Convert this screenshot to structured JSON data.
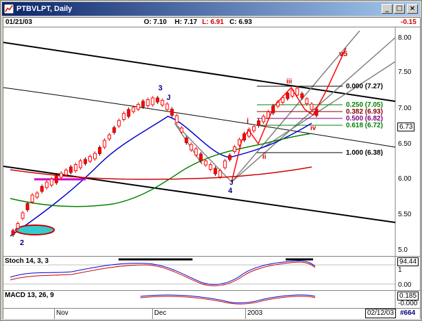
{
  "window": {
    "title": "PTBVLPT, Daily",
    "buttons": [
      "_",
      "□",
      "×"
    ]
  },
  "infobar": {
    "date": "01/21/03",
    "open": "O: 7.10",
    "high": "H: 7.17",
    "low": "L: 6.91",
    "close": "C: 6.93",
    "change": "-0.15"
  },
  "price_axis": {
    "ticks": [
      "8.00",
      "7.50",
      "7.00",
      "6.50",
      "6.00",
      "5.50",
      "5.0"
    ],
    "current": "6.73"
  },
  "fibonacci": [
    {
      "label": "0.000 (7.27)",
      "color": "#000000"
    },
    {
      "label": "0.250 (7.05)",
      "color": "#008000"
    },
    {
      "label": "0.382 (6.93)",
      "color": "#800000"
    },
    {
      "label": "0.500 (6.82)",
      "color": "#800080"
    },
    {
      "label": "0.618 (6.72)",
      "color": "#008000"
    },
    {
      "label": "1.000 (6.38)",
      "color": "#000000"
    }
  ],
  "wave_labels": {
    "w2": "2",
    "w3": "3",
    "w4": "4",
    "j1": "J",
    "j2": "J",
    "i": "i",
    "ii": "ii",
    "iii": "iii",
    "iv": "iv",
    "v5": "v5"
  },
  "stoch": {
    "title": "Stoch 14, 3, 3",
    "value": "94.44",
    "ticks": [
      "1",
      "0.00"
    ]
  },
  "macd": {
    "title": "MACD 13, 26, 9",
    "value": "0.185",
    "value2": "-0.000"
  },
  "dates": {
    "nov": "Nov",
    "dec": "Dec",
    "y2003": "2003",
    "cursor_date": "02/12/03",
    "bar_count": "#664"
  },
  "colors": {
    "up": "#ff0000",
    "ma_short": "#0000cc",
    "ma_mid": "#008000",
    "ma_long": "#cc0000",
    "channel": "#000000",
    "pitchfork": "#808080"
  }
}
